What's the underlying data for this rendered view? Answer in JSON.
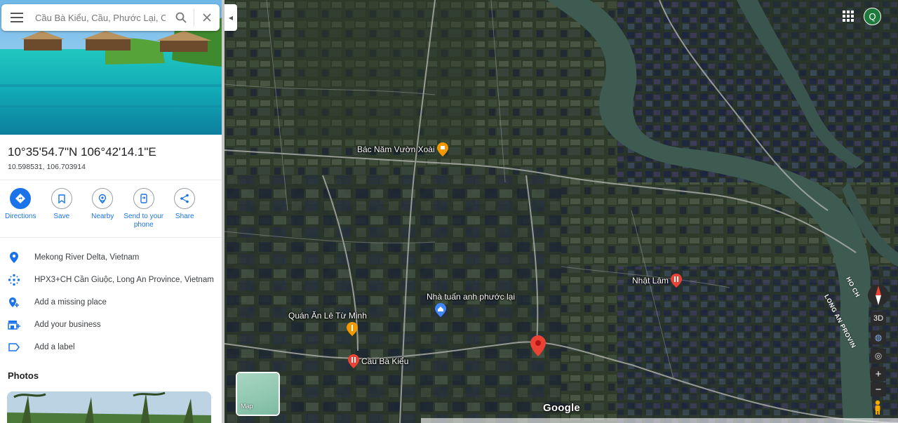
{
  "search": {
    "value": "Cầu Bà Kiểu, Cầu, Phước Lại, Cần",
    "search_icon": "search-icon",
    "close_icon": "close-icon"
  },
  "place": {
    "title": "10°35'54.7\"N 106°42'14.1\"E",
    "decimal": "10.598531, 106.703914"
  },
  "actions": [
    {
      "label": "Directions",
      "icon": "directions-icon"
    },
    {
      "label": "Save",
      "icon": "bookmark-icon"
    },
    {
      "label": "Nearby",
      "icon": "nearby-icon"
    },
    {
      "label": "Send to your phone",
      "icon": "send-to-phone-icon"
    },
    {
      "label": "Share",
      "icon": "share-icon"
    }
  ],
  "info": [
    {
      "text": "Mekong River Delta, Vietnam",
      "icon": "location-pin-icon"
    },
    {
      "text": "HPX3+CH Cần Giuộc, Long An Province, Vietnam",
      "icon": "plus-code-icon"
    },
    {
      "text": "Add a missing place",
      "icon": "add-place-icon"
    },
    {
      "text": "Add your business",
      "icon": "business-icon"
    },
    {
      "text": "Add a label",
      "icon": "label-icon"
    }
  ],
  "photos": {
    "title": "Photos"
  },
  "map": {
    "pois": [
      {
        "name": "Bác Năm Vườn Xoài",
        "icon": "shopping-pin-icon"
      },
      {
        "name": "Nhà tuấn anh phước lại",
        "icon": "home-pin-icon"
      },
      {
        "name": "Quán Ăn Lê Từ Minh",
        "icon": "food-pin-icon"
      },
      {
        "name": "Cầu Bà Kiểu",
        "icon": "restaurant-pin-icon"
      },
      {
        "name": "Nhật Lâm",
        "icon": "restaurant-pin-icon"
      }
    ],
    "roads": [
      "HO CH",
      "LONG AN PROVIN"
    ],
    "layer_toggle": "Map",
    "logo": "Google",
    "controls": {
      "three_d": "3D",
      "zoom_in": "+",
      "zoom_out": "−"
    },
    "avatar_letter": "Q"
  },
  "colors": {
    "accent": "#1a73e8",
    "pin": "#ea4335",
    "avatar": "#1e7a3a"
  }
}
